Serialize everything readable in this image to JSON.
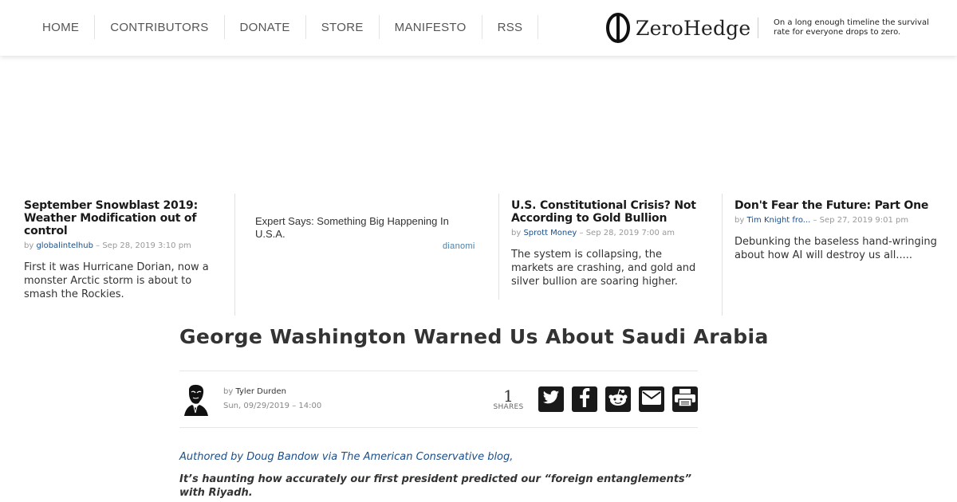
{
  "nav": {
    "items": [
      "HOME",
      "CONTRIBUTORS",
      "DONATE",
      "STORE",
      "MANIFESTO",
      "RSS"
    ]
  },
  "logo": {
    "text": "ZeroHedge",
    "icon": "zerohedge-logo-mark"
  },
  "tagline": "On a long enough timeline the survival rate for everyone drops to zero.",
  "teasers": [
    {
      "title": "September Snowblast 2019: Weather Modification out of control",
      "by": "by",
      "author": "globalintelhub",
      "date": "– Sep 28, 2019 3:10 pm",
      "summary": "First it was Hurricane Dorian, now a monster Arctic storm is about to smash the Rockies."
    },
    {
      "title": "U.S. Constitutional Crisis? Not According to Gold Bullion",
      "by": "by",
      "author": "Sprott Money",
      "date": "– Sep 28, 2019 7:00 am",
      "summary": "The system is collapsing, the markets are crashing, and gold and silver bullion are soaring higher."
    },
    {
      "title": "Don't Fear the Future: Part One",
      "by": "by",
      "author": "Tim Knight fro...",
      "date": "– Sep 27, 2019 9:01 pm",
      "summary": "Debunking the baseless hand-wringing about how AI will destroy us all....."
    }
  ],
  "sponsored": {
    "text": "Expert Says: Something Big Happening In U.S.A.",
    "provider": "dianomi"
  },
  "article": {
    "title": "George Washington Warned Us About Saudi Arabia",
    "by": "by",
    "author": "Tyler Durden",
    "date": "Sun, 09/29/2019 – 14:00",
    "shares_count": "1",
    "shares_label": "SHARES",
    "share_buttons": [
      "twitter-icon",
      "facebook-icon",
      "reddit-icon",
      "email-icon",
      "print-icon"
    ],
    "intro": "Authored by Doug Bandow via The American Conservative blog,",
    "lead": "It’s haunting how accurately our first president predicted our “foreign entanglements” with Riyadh."
  },
  "colors": {
    "link_blue": "#1a4f8a",
    "share_button_bg": "#1a1a1a",
    "nav_text": "#555555"
  }
}
